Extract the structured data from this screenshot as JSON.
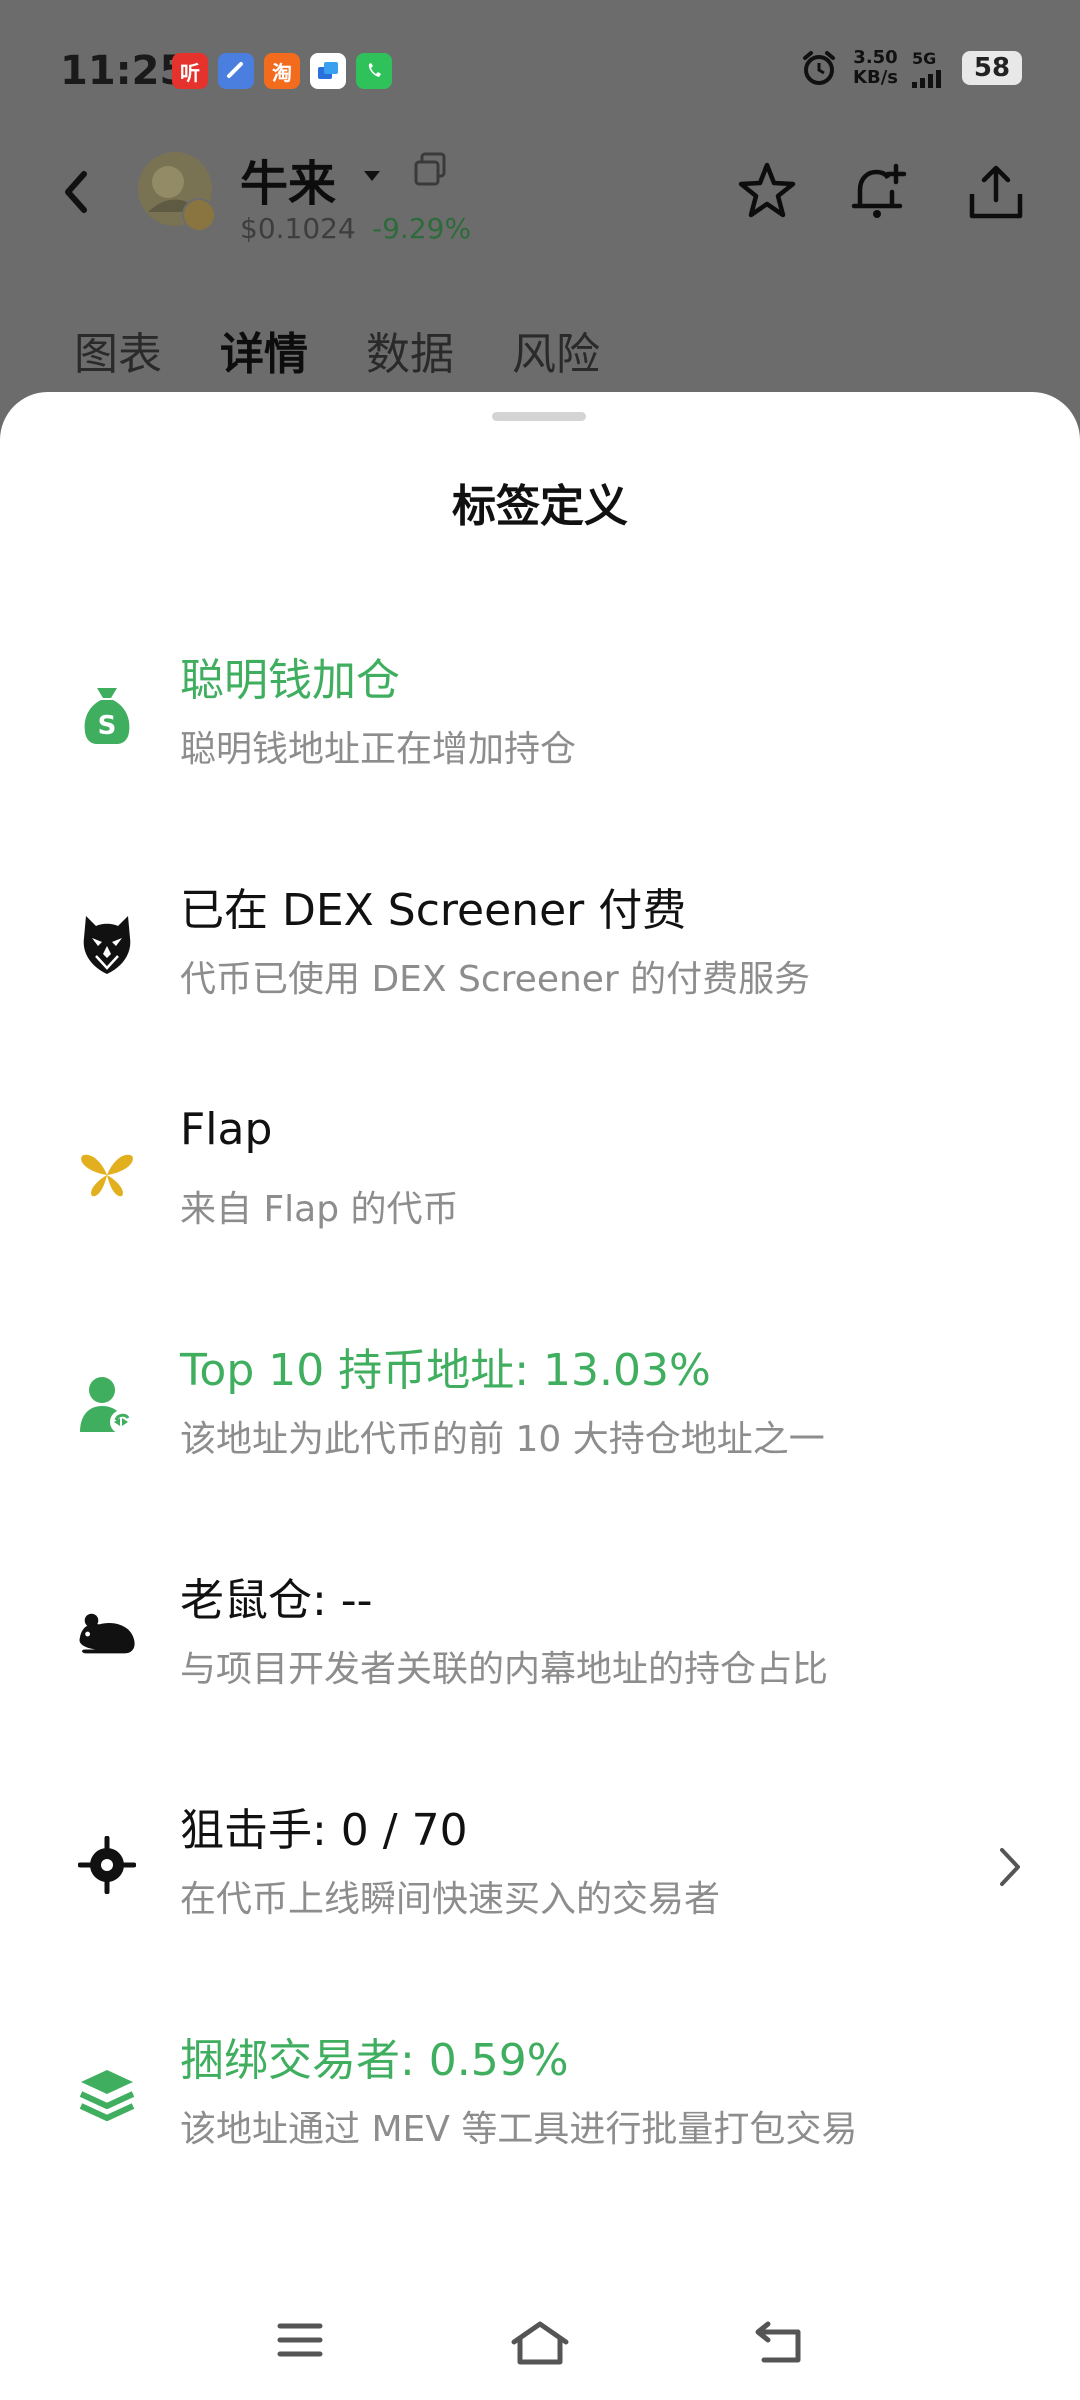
{
  "status_bar": {
    "time": "11:25",
    "app_icons": [
      {
        "glyph": "听",
        "color": "#e5322d",
        "name": "listen-app-icon"
      },
      {
        "glyph": "",
        "color": "#4a7fe0",
        "name": "browser-app-icon"
      },
      {
        "glyph": "淘",
        "color": "#f36b1c",
        "name": "taobao-app-icon"
      },
      {
        "glyph": "",
        "color": "#ffffff",
        "name": "alipay-app-icon"
      },
      {
        "glyph": "",
        "color": "#2fc25b",
        "name": "phone-app-icon"
      }
    ],
    "net_speed_value": "3.50",
    "net_speed_unit": "KB/s",
    "network": "5G",
    "battery": "58"
  },
  "header": {
    "token_name": "牛来",
    "price": "$0.1024",
    "change": "-9.29%",
    "accent_green": "#3fae5f"
  },
  "tabs": [
    {
      "label": "图表",
      "active": false
    },
    {
      "label": "详情",
      "active": true
    },
    {
      "label": "数据",
      "active": false
    },
    {
      "label": "风险",
      "active": false
    }
  ],
  "sheet": {
    "title": "标签定义",
    "items": [
      {
        "icon": "money-bag-icon",
        "title": "聪明钱加仓",
        "desc": "聪明钱地址正在增加持仓",
        "green": true
      },
      {
        "icon": "owl-icon",
        "title": "已在 DEX Screener 付费",
        "desc": "代币已使用 DEX Screener 的付费服务",
        "green": false
      },
      {
        "icon": "butterfly-icon",
        "title": "Flap",
        "desc": "来自 Flap 的代币",
        "green": false
      },
      {
        "icon": "user-plus-icon",
        "title": "Top 10 持币地址: 13.03%",
        "desc": "该地址为此代币的前 10 大持仓地址之一",
        "green": true
      },
      {
        "icon": "rat-icon",
        "title": "老鼠仓: --",
        "desc": "与项目开发者关联的内幕地址的持仓占比",
        "green": false
      },
      {
        "icon": "crosshair-icon",
        "title": "狙击手: 0 / 70",
        "desc": "在代币上线瞬间快速买入的交易者",
        "green": false
      },
      {
        "icon": "layers-icon",
        "title": "捆绑交易者: 0.59%",
        "desc": "该地址通过 MEV 等工具进行批量打包交易",
        "green": true
      }
    ]
  }
}
